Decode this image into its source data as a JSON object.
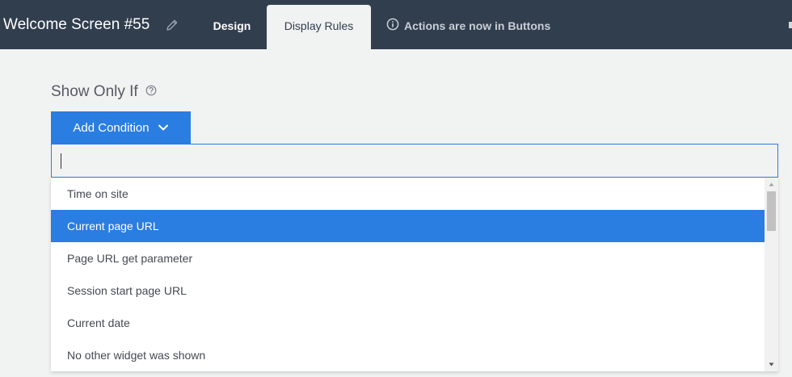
{
  "header": {
    "title": "Welcome Screen #55",
    "tabs": [
      {
        "label": "Design"
      },
      {
        "label": "Display Rules"
      }
    ],
    "notice": "Actions are now in Buttons"
  },
  "main": {
    "section_title": "Show Only If",
    "add_button_label": "Add Condition",
    "search_value": "",
    "options": [
      {
        "label": "Time on site"
      },
      {
        "label": "Current page URL"
      },
      {
        "label": "Page URL get parameter"
      },
      {
        "label": "Session start page URL"
      },
      {
        "label": "Current date"
      },
      {
        "label": "No other widget was shown"
      }
    ],
    "selected_option": "Current page URL"
  },
  "colors": {
    "topbar": "#313e4e",
    "accent": "#2a7de1",
    "background": "#f1f2f2"
  },
  "icons": {
    "edit": "pencil-icon",
    "info": "info-icon",
    "help": "help-icon",
    "dropdown": "chevron-down-icon"
  }
}
